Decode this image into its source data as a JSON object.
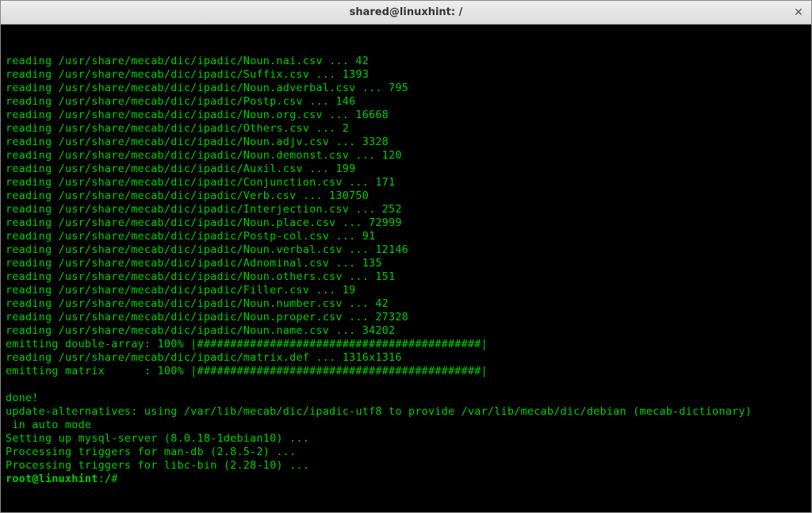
{
  "window": {
    "title": "shared@linuxhint: /"
  },
  "terminal": {
    "lines": [
      "reading /usr/share/mecab/dic/ipadic/Noun.nai.csv ... 42",
      "reading /usr/share/mecab/dic/ipadic/Suffix.csv ... 1393",
      "reading /usr/share/mecab/dic/ipadic/Noun.adverbal.csv ... 795",
      "reading /usr/share/mecab/dic/ipadic/Postp.csv ... 146",
      "reading /usr/share/mecab/dic/ipadic/Noun.org.csv ... 16668",
      "reading /usr/share/mecab/dic/ipadic/Others.csv ... 2",
      "reading /usr/share/mecab/dic/ipadic/Noun.adjv.csv ... 3328",
      "reading /usr/share/mecab/dic/ipadic/Noun.demonst.csv ... 120",
      "reading /usr/share/mecab/dic/ipadic/Auxil.csv ... 199",
      "reading /usr/share/mecab/dic/ipadic/Conjunction.csv ... 171",
      "reading /usr/share/mecab/dic/ipadic/Verb.csv ... 130750",
      "reading /usr/share/mecab/dic/ipadic/Interjection.csv ... 252",
      "reading /usr/share/mecab/dic/ipadic/Noun.place.csv ... 72999",
      "reading /usr/share/mecab/dic/ipadic/Postp-col.csv ... 91",
      "reading /usr/share/mecab/dic/ipadic/Noun.verbal.csv ... 12146",
      "reading /usr/share/mecab/dic/ipadic/Adnominal.csv ... 135",
      "reading /usr/share/mecab/dic/ipadic/Noun.others.csv ... 151",
      "reading /usr/share/mecab/dic/ipadic/Filler.csv ... 19",
      "reading /usr/share/mecab/dic/ipadic/Noun.number.csv ... 42",
      "reading /usr/share/mecab/dic/ipadic/Noun.proper.csv ... 27328",
      "reading /usr/share/mecab/dic/ipadic/Noun.name.csv ... 34202",
      "emitting double-array: 100% |###########################################| ",
      "reading /usr/share/mecab/dic/ipadic/matrix.def ... 1316x1316",
      "emitting matrix      : 100% |###########################################| ",
      "",
      "done!",
      "update-alternatives: using /var/lib/mecab/dic/ipadic-utf8 to provide /var/lib/mecab/dic/debian (mecab-dictionary)",
      " in auto mode",
      "Setting up mysql-server (8.0.18-1debian10) ...",
      "Processing triggers for man-db (2.8.5-2) ...",
      "Processing triggers for libc-bin (2.28-10) ..."
    ],
    "prompt": {
      "user_host": "root@linuxhint",
      "separator": ":",
      "path": "/",
      "symbol": "#"
    }
  }
}
